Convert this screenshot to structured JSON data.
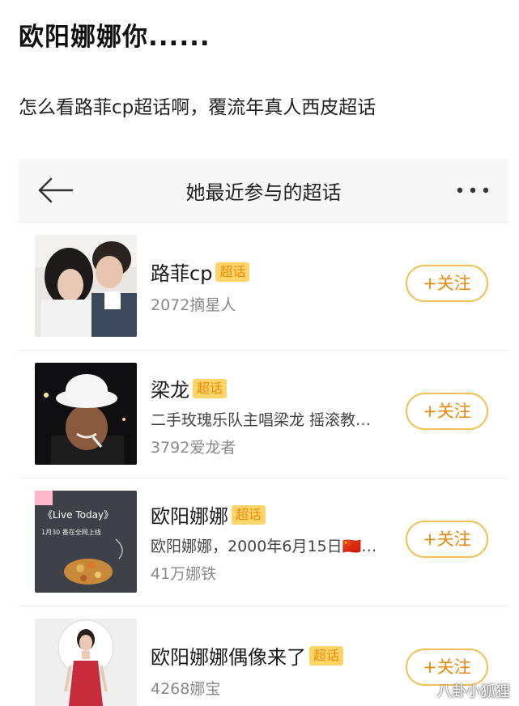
{
  "post": {
    "title": "欧阳娜娜你......",
    "text": "怎么看路菲cp超话啊，覆流年真人西皮超话"
  },
  "panel": {
    "header_title": "她最近参与的超话",
    "back_icon": "arrow-left-icon",
    "more_icon": "more-dots-icon"
  },
  "badge_label": "超话",
  "follow_label": "+关注",
  "topics": [
    {
      "name": "路菲cp",
      "description": "",
      "followers": "2072摘星人",
      "image": "couple-photo"
    },
    {
      "name": "梁龙",
      "description": "二手玫瑰乐队主唱梁龙 摇滚教…",
      "followers": "3792爱龙者",
      "image": "man-in-white-hat-photo"
    },
    {
      "name": "欧阳娜娜",
      "description": "欧阳娜娜，2000年6月15日🇨🇳…",
      "followers": "41万娜铁",
      "image": "live-today-poster",
      "poster_text": [
        "《Live Today》",
        "1月30 番在全网上线"
      ]
    },
    {
      "name": "欧阳娜娜偶像来了",
      "description": "",
      "followers": "4268娜宝",
      "image": "woman-in-red-dress-photo"
    }
  ],
  "watermark": "八卦小狐狸"
}
